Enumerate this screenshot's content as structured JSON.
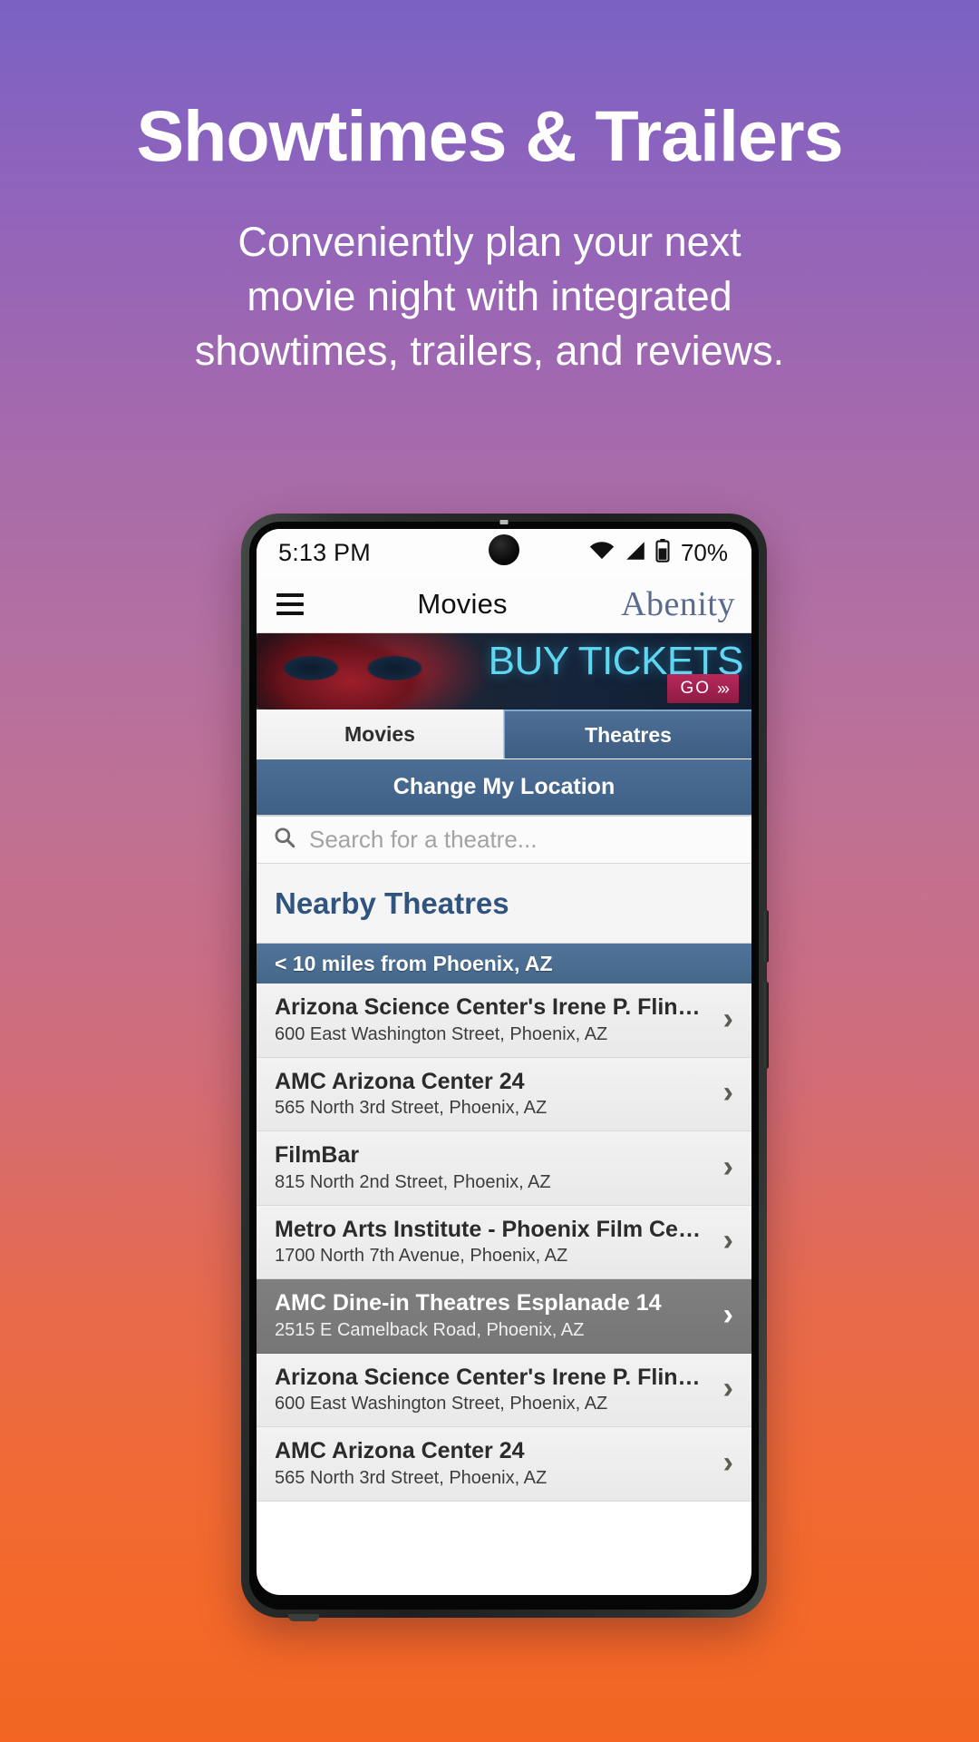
{
  "promo": {
    "title": "Showtimes & Trailers",
    "subtitle_lines": [
      "Conveniently plan your next",
      "movie night with integrated",
      "showtimes, trailers, and reviews."
    ]
  },
  "phone": {
    "status_bar": {
      "time": "5:13 PM",
      "battery_percent": "70%",
      "icons": [
        "wifi-icon",
        "cellular-signal-icon",
        "battery-icon"
      ]
    },
    "app_header": {
      "menu_icon": "hamburger-menu-icon",
      "title": "Movies",
      "brand": "Abenity"
    },
    "hero_banner": {
      "headline": "BUY TICKETS",
      "cta_label": "GO",
      "cta_chevrons": "›››",
      "artwork": "spiderman-movie-poster"
    },
    "tabs": [
      {
        "label": "Movies",
        "active": false
      },
      {
        "label": "Theatres",
        "active": true
      }
    ],
    "change_location_label": "Change My Location",
    "search": {
      "icon": "search-icon",
      "placeholder": "Search for a theatre...",
      "value": ""
    },
    "nearby_heading": "Nearby Theatres",
    "section_header": "< 10 miles from Phoenix, AZ",
    "theatres": [
      {
        "name": "Arizona Science Center's Irene P. Flinn ...",
        "address": "600 East Washington Street, Phoenix, AZ",
        "selected": false
      },
      {
        "name": "AMC Arizona Center 24",
        "address": "565 North 3rd Street, Phoenix, AZ",
        "selected": false
      },
      {
        "name": "FilmBar",
        "address": "815 North 2nd Street, Phoenix, AZ",
        "selected": false
      },
      {
        "name": "Metro Arts Institute - Phoenix Film Center",
        "address": "1700 North 7th Avenue, Phoenix, AZ",
        "selected": false
      },
      {
        "name": "AMC Dine-in Theatres Esplanade 14",
        "address": "2515 E Camelback Road, Phoenix, AZ",
        "selected": true
      },
      {
        "name": "Arizona Science Center's Irene P. Flinn ...",
        "address": "600 East Washington Street, Phoenix, AZ",
        "selected": false
      },
      {
        "name": "AMC Arizona Center 24",
        "address": "565 North 3rd Street, Phoenix, AZ",
        "selected": false
      }
    ]
  },
  "colors": {
    "gradient_top": "#7a62c2",
    "gradient_bottom": "#f26522",
    "accent_blue": "#3f6086",
    "heading_blue": "#31547f",
    "hero_cyan": "#5fd6f2",
    "cta_crimson": "#b8285c"
  }
}
